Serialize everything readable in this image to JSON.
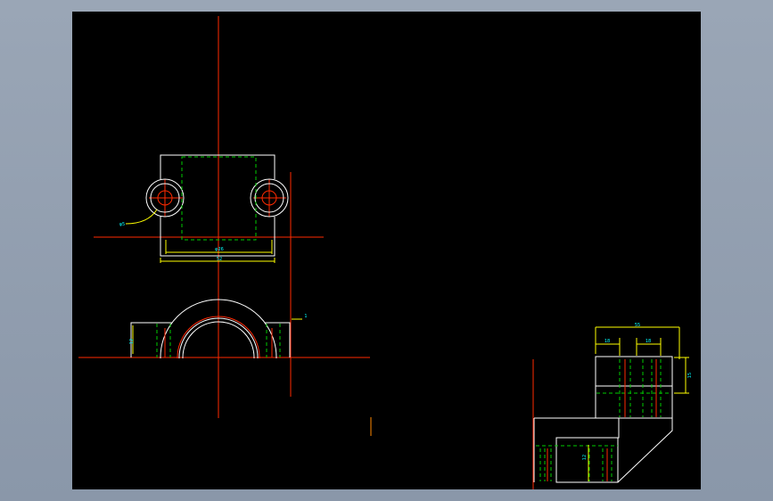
{
  "window": {
    "background": "#9aa6b6",
    "canvas_background": "#000000"
  },
  "colors": {
    "outline": "#ffffff",
    "hidden_line": "#00cc00",
    "center_line": "#ff2a00",
    "dimension": "#ffff00",
    "dimension_text": "#00ffff"
  },
  "drawing": {
    "top_view": {
      "dim_label_inner": "φ26",
      "dim_label_outer": "52",
      "leader_label": "φ5"
    },
    "front_view": {
      "dim_label_height": "12",
      "dim_label_right": "1"
    },
    "side_view": {
      "dim_label_top": "55",
      "dim_label_left": "18",
      "dim_label_mid": "18",
      "dim_label_right": "15",
      "dim_label_inner": "12"
    }
  }
}
